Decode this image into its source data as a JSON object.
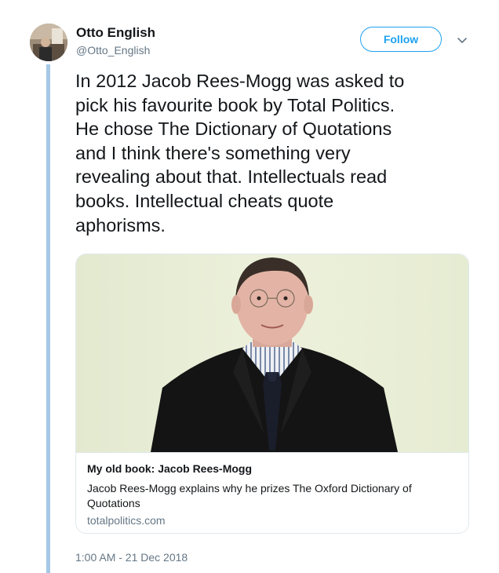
{
  "author": {
    "name": "Otto English",
    "handle": "@Otto_English"
  },
  "follow_label": "Follow",
  "tweet": {
    "text": "In 2012 Jacob Rees-Mogg was asked to\npick his favourite book by Total Politics.\nHe chose The Dictionary of Quotations\nand I think there's something very\nrevealing about that. Intellectuals read\nbooks. Intellectual cheats quote\naphorisms."
  },
  "card": {
    "title": "My old book: Jacob Rees-Mogg",
    "description": "Jacob Rees-Mogg explains why he prizes The Oxford Dictionary of Quotations",
    "domain": "totalpolitics.com"
  },
  "timestamp": "1:00 AM - 21 Dec 2018",
  "colors": {
    "accent": "#1da1f2",
    "thread_line": "#a5c8e6",
    "muted_text": "#657786",
    "border": "#e1e8ed"
  },
  "icons": [
    "chevron-down-icon"
  ]
}
